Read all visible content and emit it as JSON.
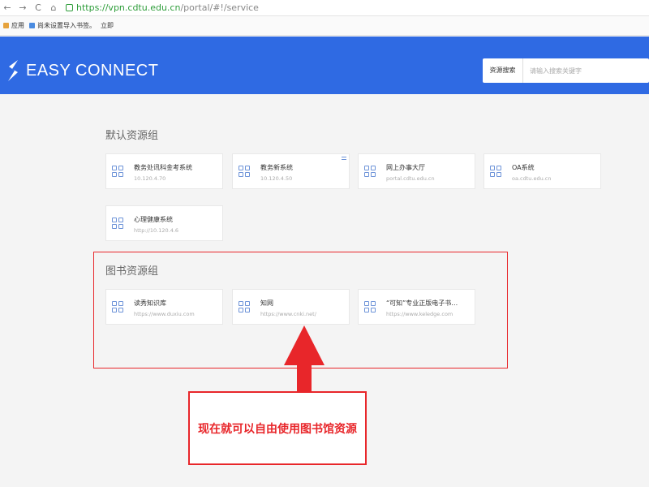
{
  "browser": {
    "url_secure": "https://vpn.cdtu.edu.cn",
    "url_rest": "/portal/#!/service",
    "bookmarks": [
      {
        "label": "应用",
        "color": "#e6a23c"
      },
      {
        "label": "尚未设置导入书签。",
        "color": "#4a8be0"
      },
      {
        "label": "立即",
        "color": "#f0c040"
      }
    ]
  },
  "header": {
    "brand": "EASY CONNECT",
    "search_label": "资源搜索",
    "search_placeholder": "请输入搜索关键字"
  },
  "groups": [
    {
      "title": "默认资源组",
      "resources": [
        {
          "name": "教务处讯科金考系统",
          "addr": "10.120.4.70"
        },
        {
          "name": "教务新系统",
          "addr": "10.120.4.50"
        },
        {
          "name": "网上办事大厅",
          "addr": "portal.cdtu.edu.cn"
        },
        {
          "name": "OA系统",
          "addr": "oa.cdtu.edu.cn"
        },
        {
          "name": "心理健康系统",
          "addr": "http://10.120.4.6"
        }
      ]
    },
    {
      "title": "图书资源组",
      "resources": [
        {
          "name": "读秀知识库",
          "addr": "https://www.duxiu.com"
        },
        {
          "name": "知网",
          "addr": "https://www.cnki.net/"
        },
        {
          "name": "“可知”专业正版电子书…",
          "addr": "https://www.keledge.com"
        }
      ]
    }
  ],
  "annotation": {
    "text": "现在就可以自由使用图书馆资源",
    "color": "#e8262a"
  },
  "colors": {
    "header_bg": "#2f6ae3",
    "icon": "#6d93d8"
  }
}
